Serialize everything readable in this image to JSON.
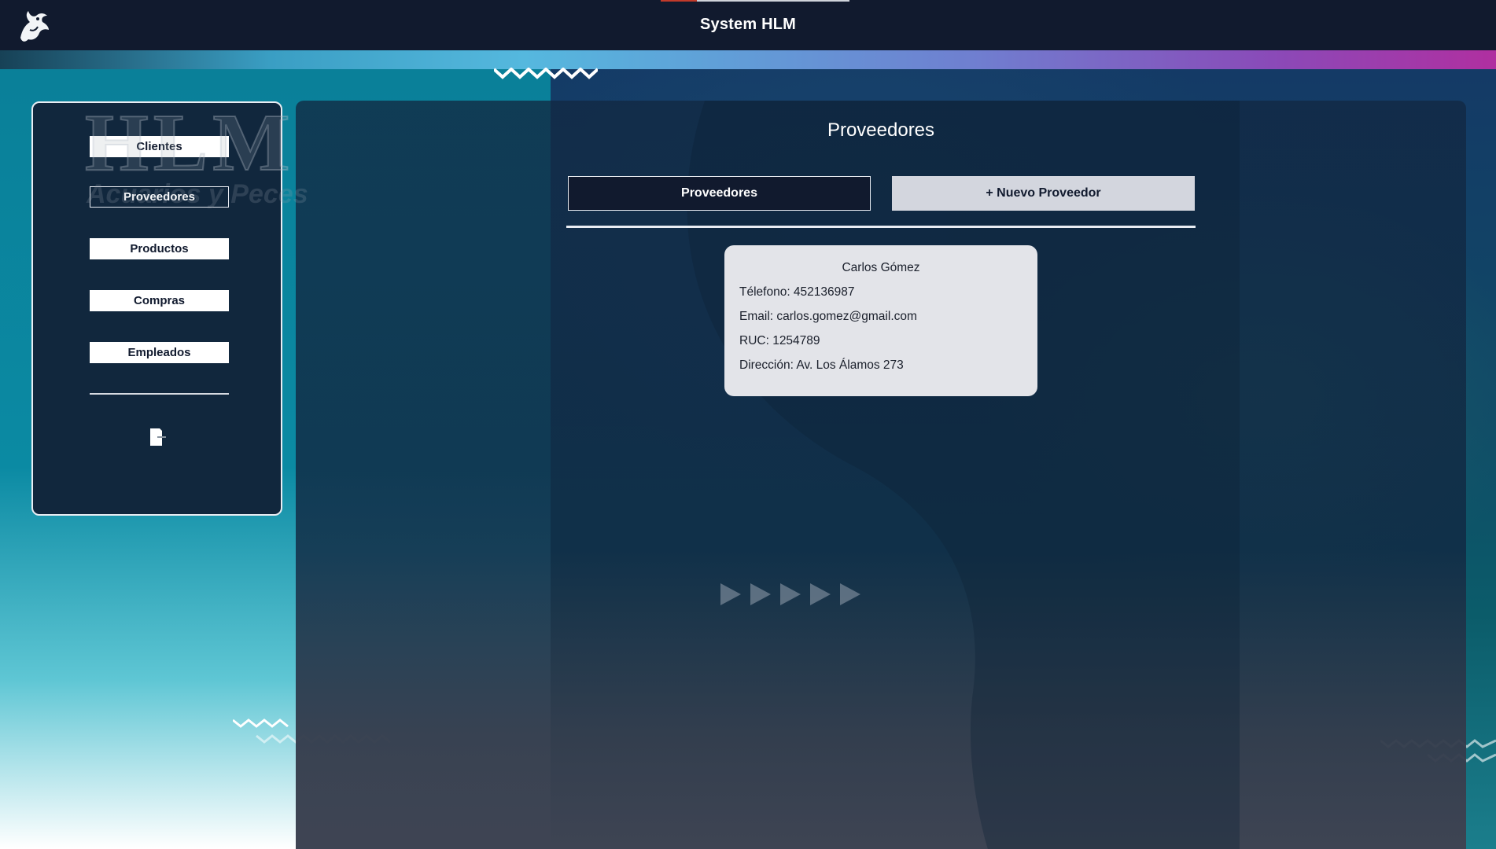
{
  "header": {
    "app_title": "System HLM"
  },
  "watermark": {
    "brand": "HLM",
    "subtitle": "Acuarios y Peces"
  },
  "sidebar": {
    "items": [
      {
        "label": "Clientes",
        "active": false
      },
      {
        "label": "Proveedores",
        "active": true
      },
      {
        "label": "Productos",
        "active": false
      },
      {
        "label": "Compras",
        "active": false
      },
      {
        "label": "Empleados",
        "active": false
      }
    ]
  },
  "main": {
    "title": "Proveedores",
    "tabs": {
      "list_label": "Proveedores",
      "new_label": "+ Nuevo Proveedor"
    },
    "suppliers": [
      {
        "name": "Carlos Gómez",
        "phone": "Télefono: 452136987",
        "email": "Email: carlos.gomez@gmail.com",
        "ruc": "RUC: 1254789",
        "address": "Dirección: Av. Los Álamos 273"
      }
    ]
  },
  "colors": {
    "topbar": "#111a2e",
    "panel": "#11273d",
    "card": "#e3e4e9",
    "accent_gradient_start": "#3a9ec3",
    "accent_gradient_end": "#b02fa0"
  },
  "icons": {
    "logo": "mascot-logo-icon",
    "logout": "logout-icon",
    "decoration": "zigzag-icon"
  }
}
